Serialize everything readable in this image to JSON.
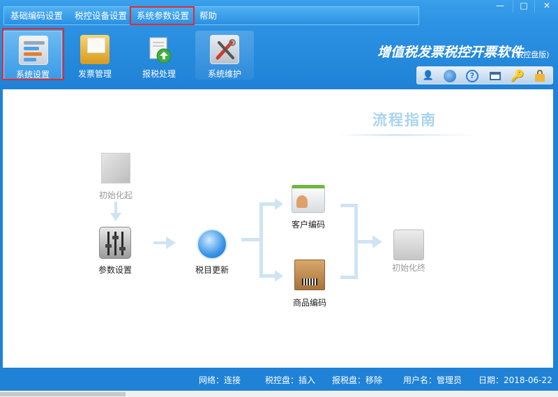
{
  "menu": {
    "items": [
      {
        "label": "基础编码设置"
      },
      {
        "label": "税控设备设置"
      },
      {
        "label": "系统参数设置"
      },
      {
        "label": "帮助"
      }
    ]
  },
  "window": {
    "minimize": "—",
    "maximize": "□",
    "close": "✕"
  },
  "toolbar": {
    "items": [
      {
        "label": "系统设置",
        "icon": "settings-panel-icon"
      },
      {
        "label": "发票管理",
        "icon": "invoice-folder-icon"
      },
      {
        "label": "报税处理",
        "icon": "tax-report-icon"
      },
      {
        "label": "系统维护",
        "icon": "maintenance-tools-icon"
      }
    ]
  },
  "brand": {
    "title": "增值税发票税控开票软件",
    "subtitle": "(税控盘版)"
  },
  "quick_icons": [
    "user-icon",
    "globe-icon",
    "help-icon",
    "window-icon",
    "key-icon",
    "lock-icon"
  ],
  "quick_glyphs": {
    "user": "👤",
    "help": "?",
    "key": "🔑"
  },
  "guide": {
    "title": "流程指南",
    "nodes": {
      "init_start": "初始化起",
      "param_setting": "参数设置",
      "tax_update": "税目更新",
      "customer_code": "客户编码",
      "goods_code": "商品编码",
      "init_end": "初始化终"
    }
  },
  "status": {
    "network": "网络：连接",
    "tax_disk": "税控盘：插入",
    "report_disk": "报税盘：移除",
    "user": "用户名：管理员",
    "date": "日期：2018-06-22"
  },
  "colors": {
    "accent": "#2a8ad8",
    "highlight": "#e52b2b",
    "flow_arrow": "#cfe4f3"
  }
}
